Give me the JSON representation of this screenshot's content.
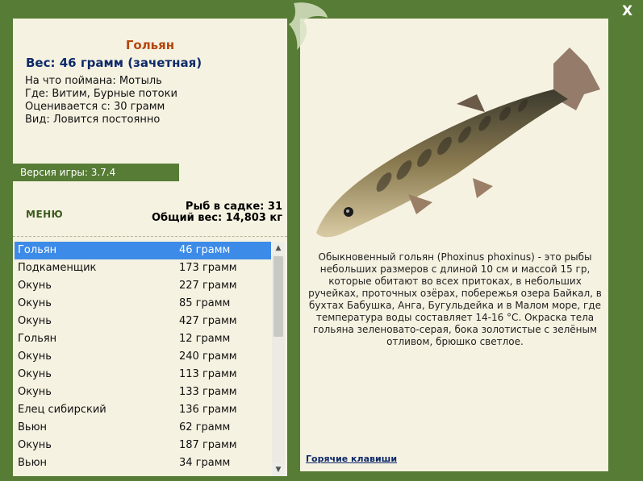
{
  "fish": {
    "name": "Гольян",
    "weight": "Вес: 46 грамм (зачетная)",
    "bait": "На что поймана: Мотыль",
    "location": "Где: Витим, Бурные потоки",
    "valued": "Оценивается с: 30 грамм",
    "kind": "Вид: Ловится постоянно"
  },
  "version": "Версия игры: 3.7.4",
  "menu_label": "МЕНЮ",
  "stats": {
    "count": "Рыб в садке: 31",
    "total": "Общий вес: 14,803 кг"
  },
  "catch_list": [
    {
      "name": "Гольян",
      "weight": "46 грамм"
    },
    {
      "name": "Подкаменщик",
      "weight": "173 грамм"
    },
    {
      "name": "Окунь",
      "weight": "227 грамм"
    },
    {
      "name": "Окунь",
      "weight": "85 грамм"
    },
    {
      "name": "Окунь",
      "weight": "427 грамм"
    },
    {
      "name": "Гольян",
      "weight": "12 грамм"
    },
    {
      "name": "Окунь",
      "weight": "240 грамм"
    },
    {
      "name": "Окунь",
      "weight": "113 грамм"
    },
    {
      "name": "Окунь",
      "weight": "133 грамм"
    },
    {
      "name": "Елец сибирский",
      "weight": "136 грамм"
    },
    {
      "name": "Вьюн",
      "weight": "62 грамм"
    },
    {
      "name": "Окунь",
      "weight": "187 грамм"
    },
    {
      "name": "Вьюн",
      "weight": "34 грамм"
    }
  ],
  "description": "Обыкновенный гольян (Phoxinus phoxinus) - это рыбы небольших размеров с длиной 10 см и массой 15 гр, которые обитают во всех притоках, в небольших ручейках, проточных озёрах, побережья озера Байкал, в бухтах Бабушка, Анга, Бугульдейка и в Малом море, где температура воды составляет 14-16 °С. Окраска тела гольяна зеленовато-серая, бока золотистые с зелёным отливом, брюшко светлое.",
  "hotkeys_label": "Горячие клавиши",
  "close_label": "X"
}
